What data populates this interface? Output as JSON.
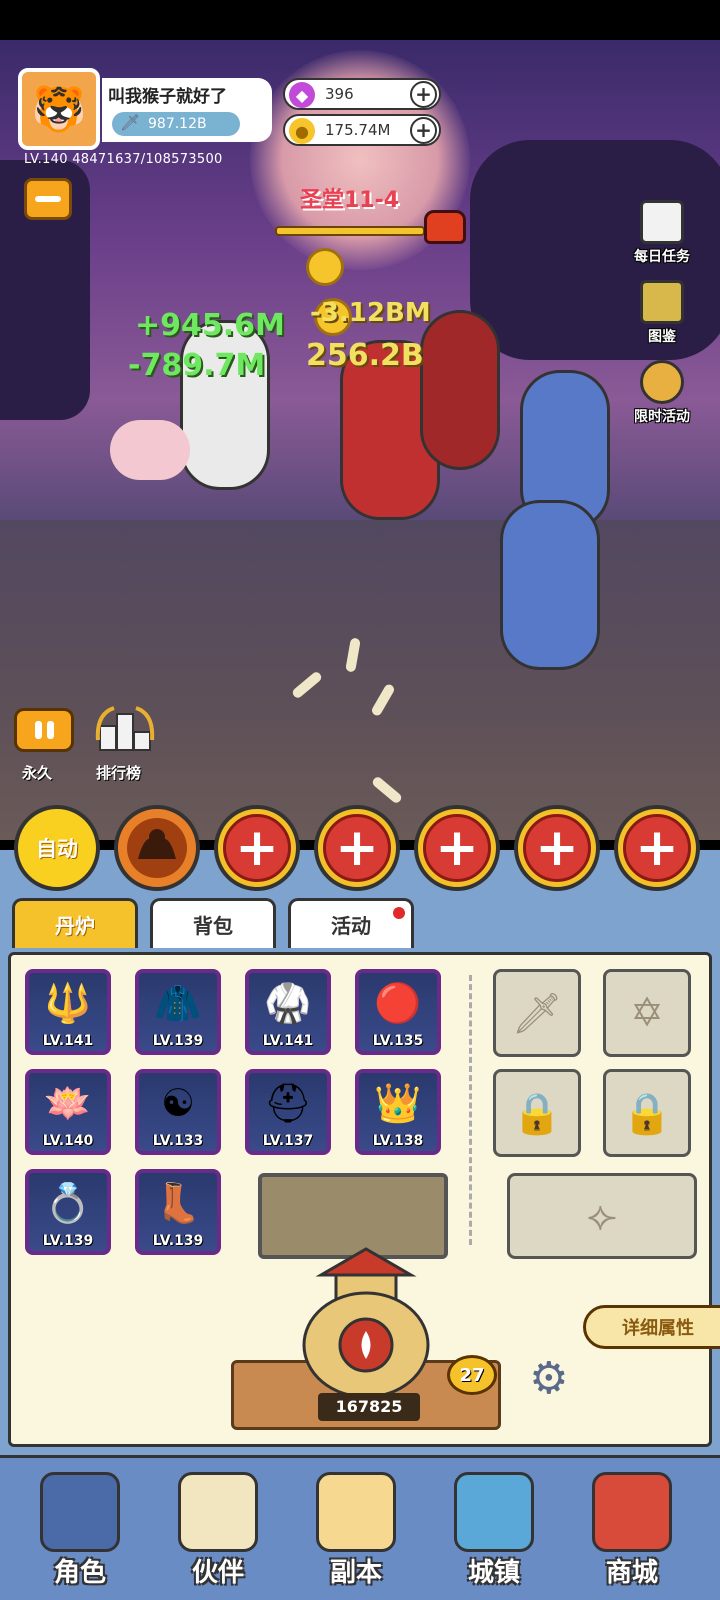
{
  "player": {
    "name": "叫我猴子就好了",
    "power": "987.12B",
    "level_exp": "LV.140 48471637/108573500",
    "avatar_icon": "tiger-avatar"
  },
  "currency": {
    "gems": "396",
    "gold": "175.74M"
  },
  "stage": {
    "title": "圣堂11-4"
  },
  "damage_numbers": [
    "+945.6M",
    "-789.7M",
    "-3.12BM",
    "256.2B"
  ],
  "right_menu": [
    {
      "label": "每日任务",
      "icon": "daily-task-icon"
    },
    {
      "label": "图鉴",
      "icon": "codex-book-icon"
    },
    {
      "label": "限时活动",
      "icon": "limited-event-icon"
    }
  ],
  "battle_controls": {
    "pause_label": "永久",
    "rank_label": "排行榜"
  },
  "skills": {
    "auto_label": "自动",
    "plus_symbol": "+"
  },
  "tabs": [
    {
      "label": "丹炉",
      "active": true
    },
    {
      "label": "背包",
      "active": false
    },
    {
      "label": "活动",
      "active": false,
      "badge": true
    }
  ],
  "items": [
    {
      "lv": "LV.141",
      "icon": "spear-icon"
    },
    {
      "lv": "LV.139",
      "icon": "cloak-icon"
    },
    {
      "lv": "LV.141",
      "icon": "armor-icon"
    },
    {
      "lv": "LV.135",
      "icon": "phoenix-orb-icon"
    },
    {
      "lv": "LV.140",
      "icon": "lotus-icon"
    },
    {
      "lv": "LV.133",
      "icon": "bagua-icon"
    },
    {
      "lv": "LV.137",
      "icon": "helmet-icon"
    },
    {
      "lv": "LV.138",
      "icon": "crown-icon"
    },
    {
      "lv": "LV.139",
      "icon": "ring-icon"
    },
    {
      "lv": "LV.139",
      "icon": "boots-icon"
    }
  ],
  "furnace": {
    "count": "167825",
    "level": "27"
  },
  "detail_button": "详细属性",
  "nav": [
    {
      "label": "角色",
      "icon": "character-icon"
    },
    {
      "label": "伙伴",
      "icon": "partner-icon"
    },
    {
      "label": "副本",
      "icon": "dungeon-scroll-icon"
    },
    {
      "label": "城镇",
      "icon": "town-icon"
    },
    {
      "label": "商城",
      "icon": "shop-icon"
    }
  ],
  "colors": {
    "accent": "#f6c22c",
    "panel_bg": "#fbf6de",
    "nav_bg": "#6a8cc4",
    "damage_green": "#6ee860",
    "stage_red": "#e94052"
  }
}
